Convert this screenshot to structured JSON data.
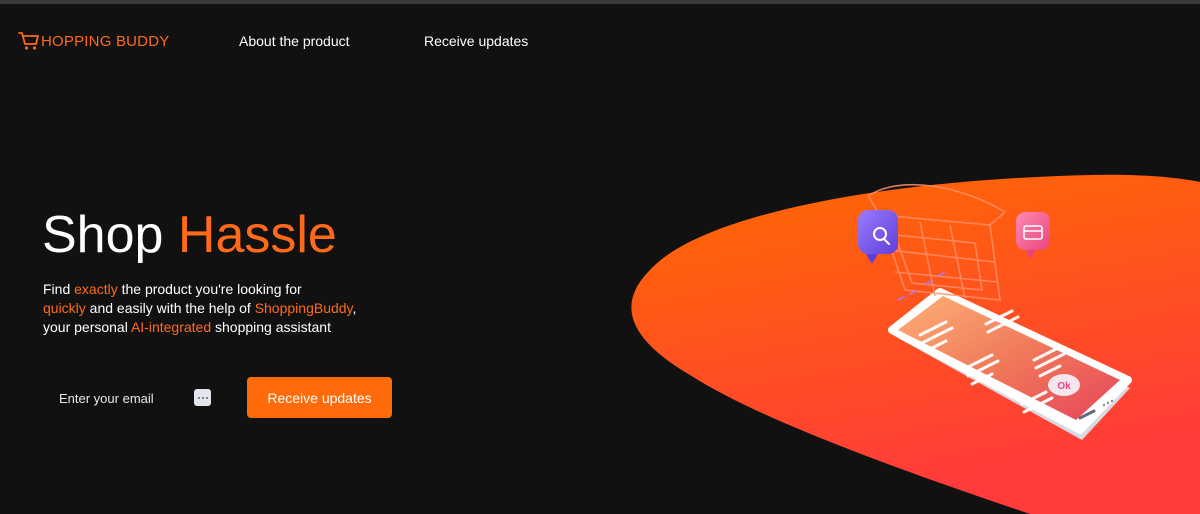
{
  "nav": {
    "logo_text": "HOPPING BUDDY",
    "links": [
      {
        "label": "About the product"
      },
      {
        "label": "Receive updates"
      }
    ]
  },
  "hero": {
    "title_part1": "Shop",
    "title_part2": "Hassle",
    "desc": {
      "l1_a": "Find ",
      "l1_accent": "exactly",
      "l1_b": " the product you're looking for",
      "l2_accent": "quickly",
      "l2_b": " and easily with the help of ",
      "l2_accent2": "ShoppingBuddy",
      "l2_c": ",",
      "l3_a": "your personal ",
      "l3_accent": "AI-integrated",
      "l3_b": " shopping assistant"
    }
  },
  "form": {
    "email_placeholder": "Enter your email",
    "email_value": "",
    "button_label": "Receive updates"
  },
  "illustration": {
    "badge_text": "Ok"
  },
  "colors": {
    "accent": "#ff6a1a",
    "background": "#121112",
    "blob_top": "#ff6a00",
    "blob_bottom": "#ff3b3b"
  }
}
